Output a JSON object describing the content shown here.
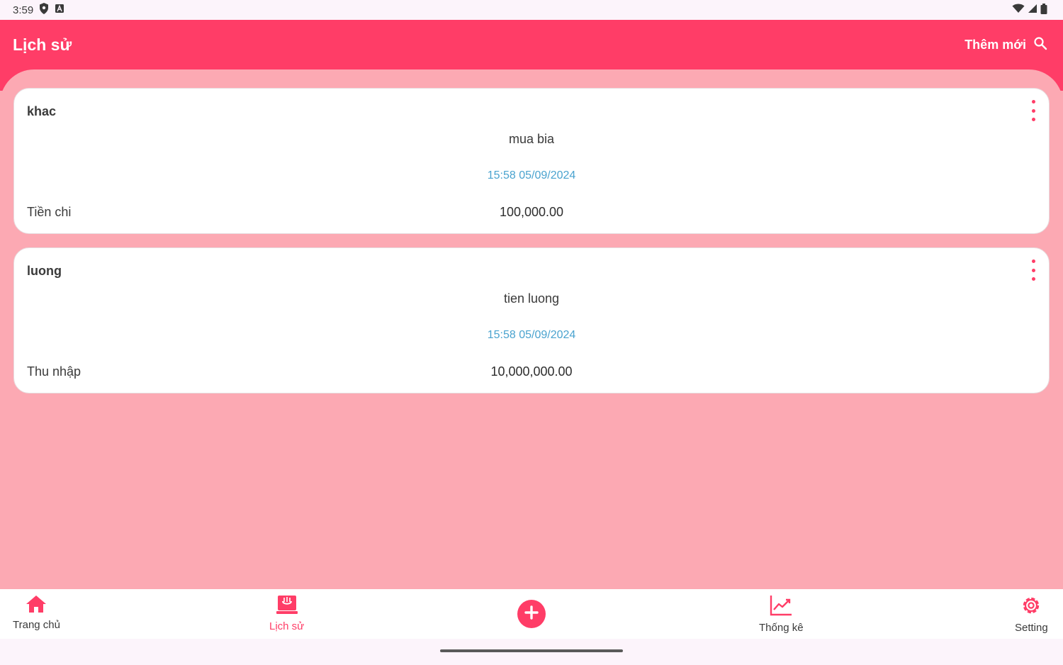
{
  "status_bar": {
    "time": "3:59"
  },
  "app_bar": {
    "title": "Lịch sử",
    "add_new_label": "Thêm mới"
  },
  "transactions": [
    {
      "category": "khac",
      "description": "mua bia",
      "datetime": "15:58 05/09/2024",
      "type": "Tiền chi",
      "amount": "100,000.00"
    },
    {
      "category": "luong",
      "description": "tien luong",
      "datetime": "15:58 05/09/2024",
      "type": "Thu nhập",
      "amount": "10,000,000.00"
    }
  ],
  "bottom_nav": {
    "items": [
      {
        "label": "Trang chủ",
        "icon": "home-icon"
      },
      {
        "label": "Lịch sử",
        "icon": "history-icon",
        "active": true
      },
      {
        "label": "",
        "icon": "add-circle-icon"
      },
      {
        "label": "Thống kê",
        "icon": "chart-icon"
      },
      {
        "label": "Setting",
        "icon": "gear-icon"
      }
    ]
  },
  "colors": {
    "primary": "#ff3d67",
    "background": "#fca9b3",
    "card": "#ffffff",
    "datetime": "#4aa3cf"
  }
}
